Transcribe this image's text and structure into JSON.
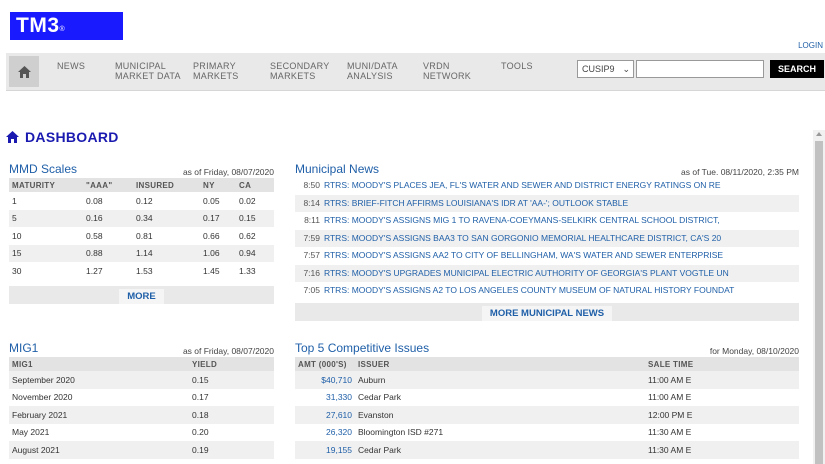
{
  "brand": {
    "logo": "TM3",
    "logo_mark": "®",
    "login": "LOGIN"
  },
  "nav": {
    "items": [
      {
        "l1": "NEWS",
        "l2": ""
      },
      {
        "l1": "MUNICIPAL",
        "l2": "MARKET DATA"
      },
      {
        "l1": "PRIMARY",
        "l2": "MARKETS"
      },
      {
        "l1": "SECONDARY",
        "l2": "MARKETS"
      },
      {
        "l1": "MUNI/DATA",
        "l2": "ANALYSIS"
      },
      {
        "l1": "VRDN",
        "l2": "NETWORK"
      },
      {
        "l1": "TOOLS",
        "l2": ""
      }
    ],
    "cusip_select": "CUSIP9",
    "search_value": "",
    "search_label": "SEARCH"
  },
  "dashboard": {
    "title": "DASHBOARD"
  },
  "mmd": {
    "title": "MMD Scales",
    "asof": "as of Friday, 08/07/2020",
    "headers": [
      "MATURITY",
      "\"AAA\"",
      "INSURED",
      "NY",
      "CA"
    ],
    "rows": [
      [
        "1",
        "0.08",
        "0.12",
        "0.05",
        "0.02"
      ],
      [
        "5",
        "0.16",
        "0.34",
        "0.17",
        "0.15"
      ],
      [
        "10",
        "0.58",
        "0.81",
        "0.66",
        "0.62"
      ],
      [
        "15",
        "0.88",
        "1.14",
        "1.06",
        "0.94"
      ],
      [
        "30",
        "1.27",
        "1.53",
        "1.45",
        "1.33"
      ]
    ],
    "more": "MORE"
  },
  "news": {
    "title": "Municipal News",
    "asof": "as of Tue. 08/11/2020, 2:35 PM",
    "items": [
      {
        "time": "8:50",
        "text": "RTRS: MOODY'S PLACES JEA, FL'S WATER AND SEWER AND DISTRICT ENERGY RATINGS ON RE"
      },
      {
        "time": "8:14",
        "text": "RTRS: BRIEF-FITCH AFFIRMS LOUISIANA'S IDR AT 'AA-'; OUTLOOK STABLE"
      },
      {
        "time": "8:11",
        "text": "RTRS: MOODY'S ASSIGNS MIG 1 TO RAVENA-COEYMANS-SELKIRK CENTRAL SCHOOL DISTRICT,"
      },
      {
        "time": "7:59",
        "text": "RTRS: MOODY'S ASSIGNS BAA3 TO SAN GORGONIO MEMORIAL HEALTHCARE DISTRICT, CA'S 20"
      },
      {
        "time": "7:57",
        "text": "RTRS: MOODY'S ASSIGNS AA2 TO CITY OF BELLINGHAM, WA'S WATER AND SEWER ENTERPRISE"
      },
      {
        "time": "7:16",
        "text": "RTRS: MOODY'S UPGRADES MUNICIPAL ELECTRIC AUTHORITY OF GEORGIA'S PLANT VOGTLE UN"
      },
      {
        "time": "7:05",
        "text": "RTRS: MOODY'S ASSIGNS A2 TO LOS ANGELES COUNTY MUSEUM OF NATURAL HISTORY FOUNDAT"
      }
    ],
    "more": "MORE MUNICIPAL NEWS"
  },
  "mig1": {
    "title": "MIG1",
    "asof": "as of Friday, 08/07/2020",
    "headers": [
      "MIG1",
      "YIELD"
    ],
    "rows": [
      [
        "September 2020",
        "0.15"
      ],
      [
        "November 2020",
        "0.17"
      ],
      [
        "February 2021",
        "0.18"
      ],
      [
        "May 2021",
        "0.20"
      ],
      [
        "August 2021",
        "0.19"
      ]
    ]
  },
  "top5": {
    "title": "Top 5 Competitive Issues",
    "asof": "for Monday, 08/10/2020",
    "headers": [
      "AMT (000'S)",
      "ISSUER",
      "SALE TIME"
    ],
    "rows": [
      [
        "$40,710",
        "Auburn",
        "11:00 AM E"
      ],
      [
        "31,330",
        "Cedar Park",
        "11:00 AM E"
      ],
      [
        "27,610",
        "Evanston",
        "12:00 PM E"
      ],
      [
        "26,320",
        "Bloomington ISD #271",
        "11:30 AM E"
      ],
      [
        "19,155",
        "Cedar Park",
        "11:30 AM E"
      ]
    ]
  },
  "colors": {
    "brand": "#1a1aff",
    "link": "#1f5fa8",
    "heading": "#1a1ab0"
  }
}
